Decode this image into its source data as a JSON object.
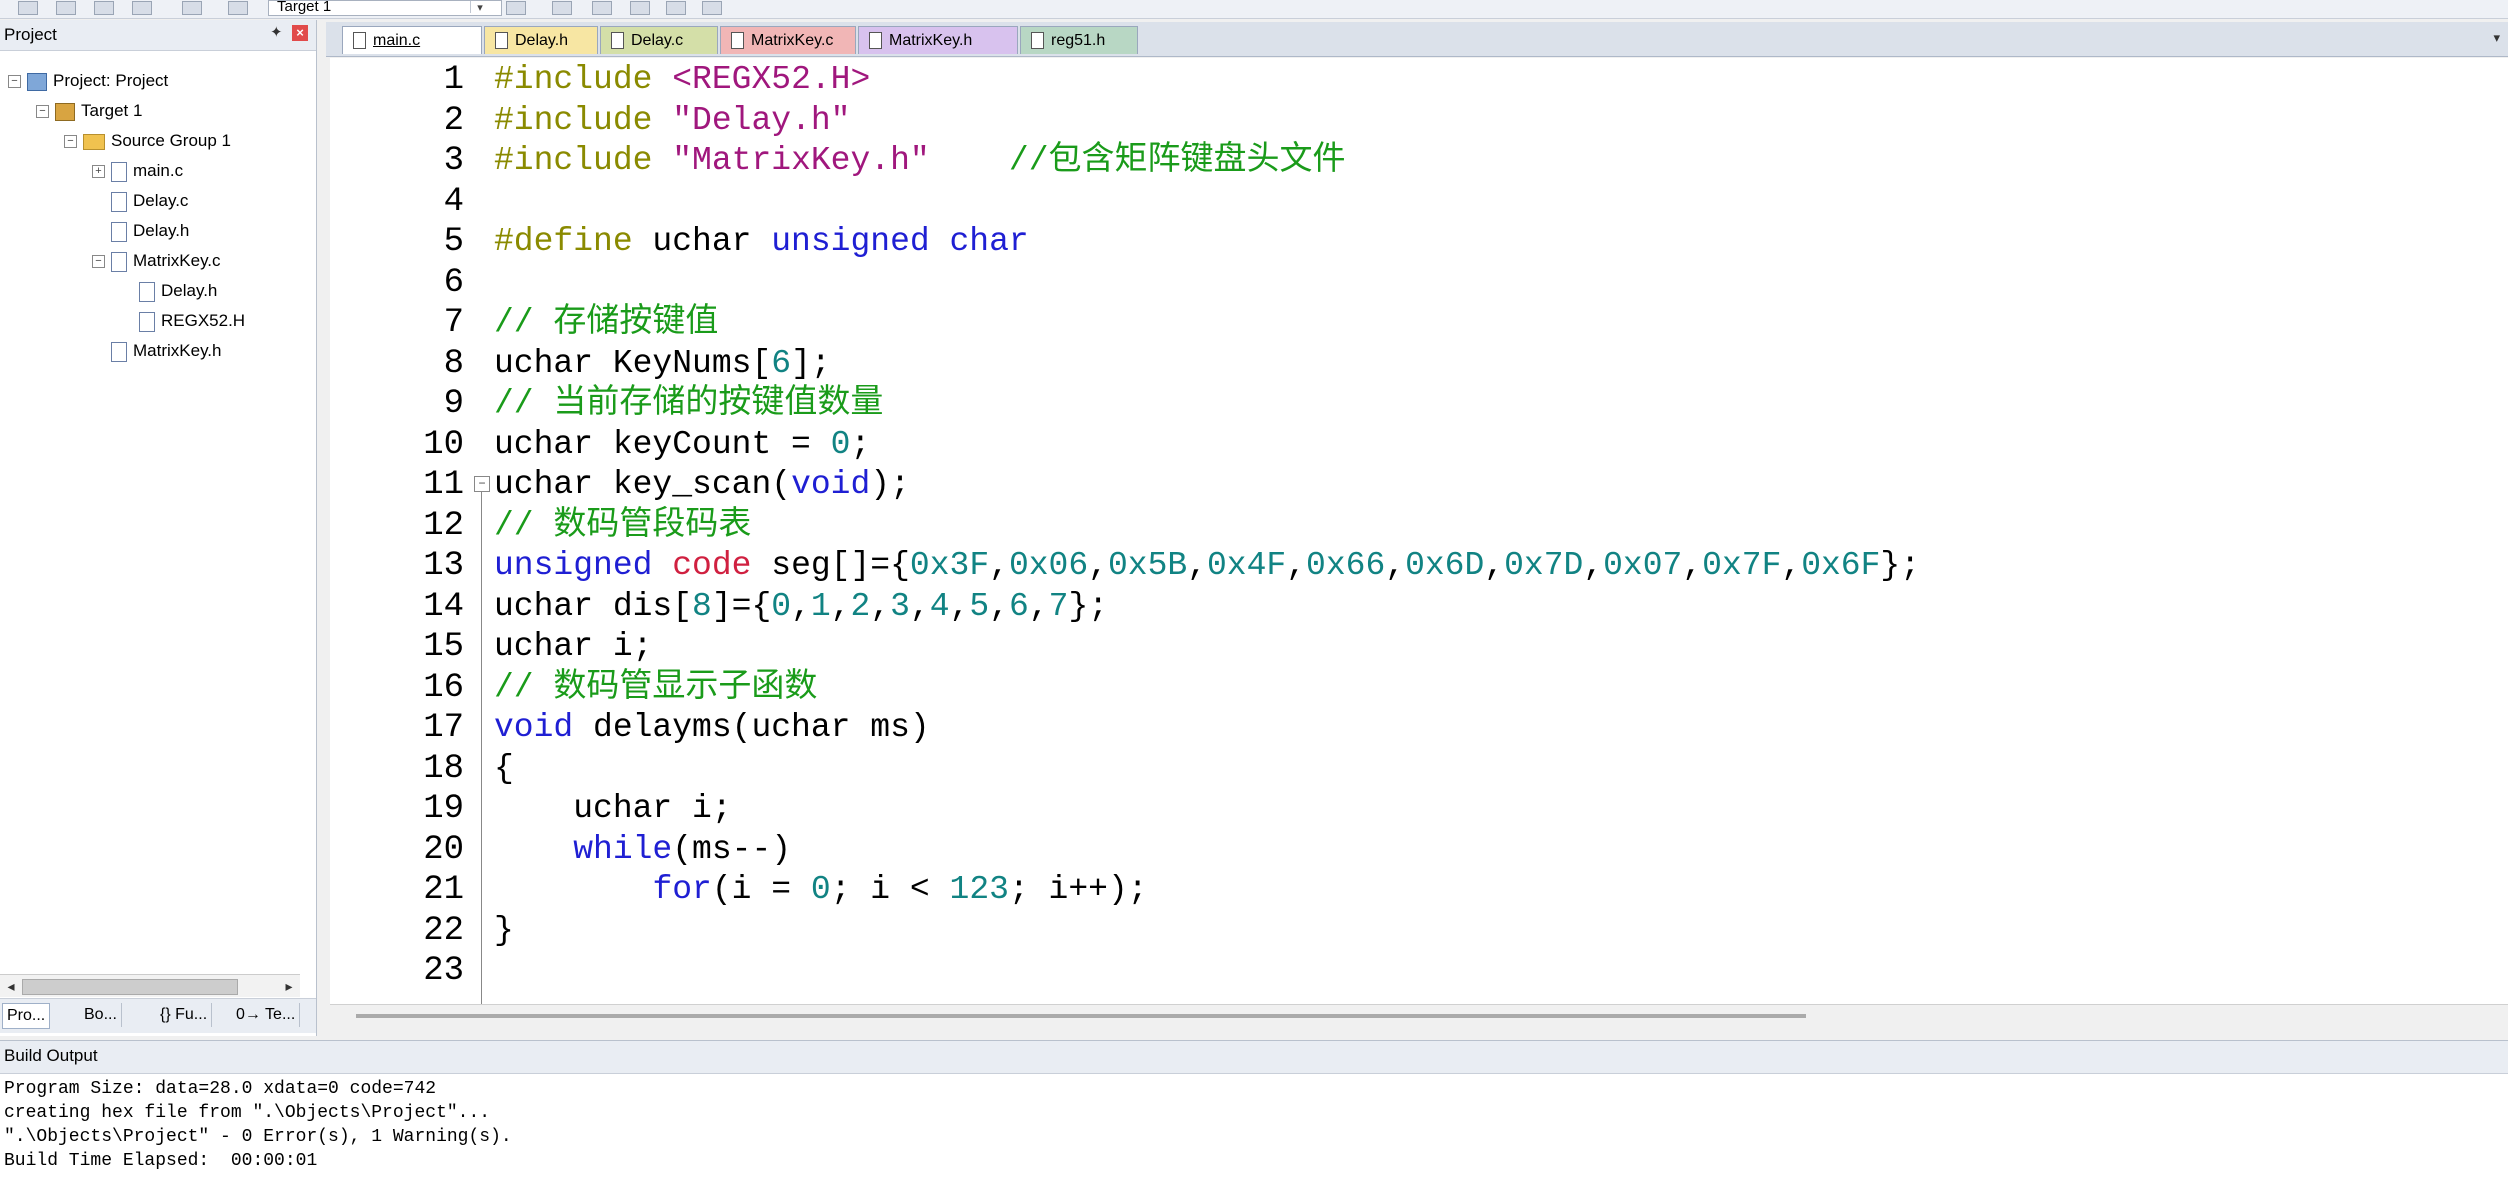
{
  "toolbar": {
    "target_select": "Target 1"
  },
  "project_panel": {
    "title": "Project",
    "tree": [
      {
        "label": "Project: Project",
        "depth": 0,
        "kind": "proj",
        "toggle": "-"
      },
      {
        "label": "Target 1",
        "depth": 1,
        "kind": "target",
        "toggle": "-"
      },
      {
        "label": "Source Group 1",
        "depth": 2,
        "kind": "folder",
        "toggle": "-"
      },
      {
        "label": "main.c",
        "depth": 3,
        "kind": "file",
        "toggle": "+"
      },
      {
        "label": "Delay.c",
        "depth": 3,
        "kind": "file",
        "toggle": ""
      },
      {
        "label": "Delay.h",
        "depth": 3,
        "kind": "file",
        "toggle": ""
      },
      {
        "label": "MatrixKey.c",
        "depth": 3,
        "kind": "file",
        "toggle": "-"
      },
      {
        "label": "Delay.h",
        "depth": 4,
        "kind": "file",
        "toggle": ""
      },
      {
        "label": "REGX52.H",
        "depth": 4,
        "kind": "file",
        "toggle": ""
      },
      {
        "label": "MatrixKey.h",
        "depth": 3,
        "kind": "file",
        "toggle": ""
      }
    ],
    "tabs": [
      "Pro...",
      "Bo...",
      "{} Fu...",
      "0→ Te..."
    ]
  },
  "editor": {
    "tabs": [
      {
        "label": "main.c",
        "color": "#dbe4f3",
        "active": true
      },
      {
        "label": "Delay.h",
        "color": "#f7e6a3",
        "active": false
      },
      {
        "label": "Delay.c",
        "color": "#d4dfa8",
        "active": false
      },
      {
        "label": "MatrixKey.c",
        "color": "#f1b6b6",
        "active": false
      },
      {
        "label": "MatrixKey.h",
        "color": "#d8c2ee",
        "active": false
      },
      {
        "label": "reg51.h",
        "color": "#b8d7c4",
        "active": false
      }
    ],
    "lines": [
      {
        "num": "1",
        "html": "<span class='p'>#include</span> <span class='s'>&lt;REGX52.H&gt;</span>"
      },
      {
        "num": "2",
        "html": "<span class='p'>#include</span> <span class='s'>\"Delay.h\"</span>"
      },
      {
        "num": "3",
        "html": "<span class='p'>#include</span> <span class='s'>\"MatrixKey.h\"</span>    <span class='c'>//包含矩阵键盘头文件</span>"
      },
      {
        "num": "4",
        "html": ""
      },
      {
        "num": "5",
        "html": "<span class='p'>#define</span> uchar <span class='k'>unsigned</span> <span class='k'>char</span>"
      },
      {
        "num": "6",
        "html": ""
      },
      {
        "num": "7",
        "html": "<span class='c'>// 存储按键值</span>"
      },
      {
        "num": "8",
        "html": "uchar KeyNums[<span class='n'>6</span>];"
      },
      {
        "num": "9",
        "html": "<span class='c'>// 当前存储的按键值数量</span>"
      },
      {
        "num": "10",
        "html": "uchar keyCount = <span class='n'>0</span>;"
      },
      {
        "num": "11",
        "html": "uchar key_scan(<span class='k'>void</span>);"
      },
      {
        "num": "12",
        "html": "<span class='c'>// 数码管段码表</span>"
      },
      {
        "num": "13",
        "html": "<span class='k'>unsigned</span> <span class='r'>code</span> seg[]={<span class='n'>0x3F</span>,<span class='n'>0x06</span>,<span class='n'>0x5B</span>,<span class='n'>0x4F</span>,<span class='n'>0x66</span>,<span class='n'>0x6D</span>,<span class='n'>0x7D</span>,<span class='n'>0x07</span>,<span class='n'>0x7F</span>,<span class='n'>0x6F</span>};"
      },
      {
        "num": "14",
        "html": "uchar dis[<span class='n'>8</span>]={<span class='n'>0</span>,<span class='n'>1</span>,<span class='n'>2</span>,<span class='n'>3</span>,<span class='n'>4</span>,<span class='n'>5</span>,<span class='n'>6</span>,<span class='n'>7</span>};"
      },
      {
        "num": "15",
        "html": "uchar i;"
      },
      {
        "num": "16",
        "html": "<span class='c'>// 数码管显示子函数</span>"
      },
      {
        "num": "17",
        "html": "<span class='k'>void</span> delayms(uchar ms)"
      },
      {
        "num": "18",
        "html": "{"
      },
      {
        "num": "19",
        "html": "    uchar i;"
      },
      {
        "num": "20",
        "html": "    <span class='k'>while</span>(ms--)"
      },
      {
        "num": "21",
        "html": "        <span class='k'>for</span>(i = <span class='n'>0</span>; i &lt; <span class='n'>123</span>; i++);"
      },
      {
        "num": "22",
        "html": "}"
      },
      {
        "num": "23",
        "html": ""
      }
    ]
  },
  "build_output": {
    "title": "Build Output",
    "lines": [
      "Program Size: data=28.0 xdata=0 code=742",
      "creating hex file from \".\\Objects\\Project\"...",
      "\".\\Objects\\Project\" - 0 Error(s), 1 Warning(s).",
      "Build Time Elapsed:  00:00:01"
    ]
  }
}
